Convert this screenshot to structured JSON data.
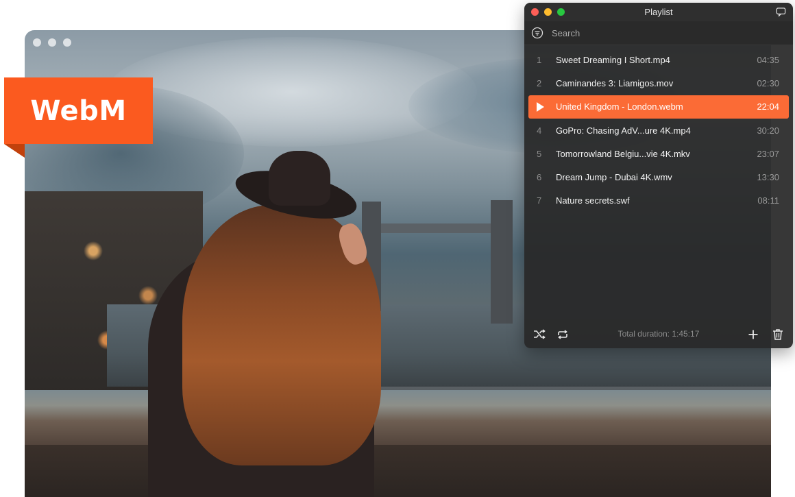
{
  "playlist": {
    "title": "Playlist",
    "search_placeholder": "Search",
    "items": [
      {
        "num": "1",
        "name": "Sweet Dreaming I Short.mp4",
        "duration": "04:35"
      },
      {
        "num": "2",
        "name": "Caminandes 3: Liamigos.mov",
        "duration": "02:30"
      },
      {
        "num": "",
        "name": "United Kingdom - London.webm",
        "duration": "22:04",
        "playing": true
      },
      {
        "num": "4",
        "name": "GoPro: Chasing AdV...ure 4K.mp4",
        "duration": "30:20"
      },
      {
        "num": "5",
        "name": "Tomorrowland Belgiu...vie 4K.mkv",
        "duration": "23:07"
      },
      {
        "num": "6",
        "name": "Dream Jump - Dubai 4K.wmv",
        "duration": "13:30"
      },
      {
        "num": "7",
        "name": "Nature secrets.swf",
        "duration": "08:11"
      }
    ],
    "total_duration": "Total duration: 1:45:17",
    "icons": {
      "chat": "chat-bubble-icon",
      "search": "filter-search-icon",
      "shuffle": "shuffle-icon",
      "repeat": "repeat-icon",
      "add": "plus-icon",
      "trash": "trash-icon",
      "play": "play-icon"
    }
  },
  "badge": {
    "label": "WebM"
  },
  "colors": {
    "accent": "#fb6b36",
    "badge": "#fb5a1f",
    "panel": "#282828"
  }
}
